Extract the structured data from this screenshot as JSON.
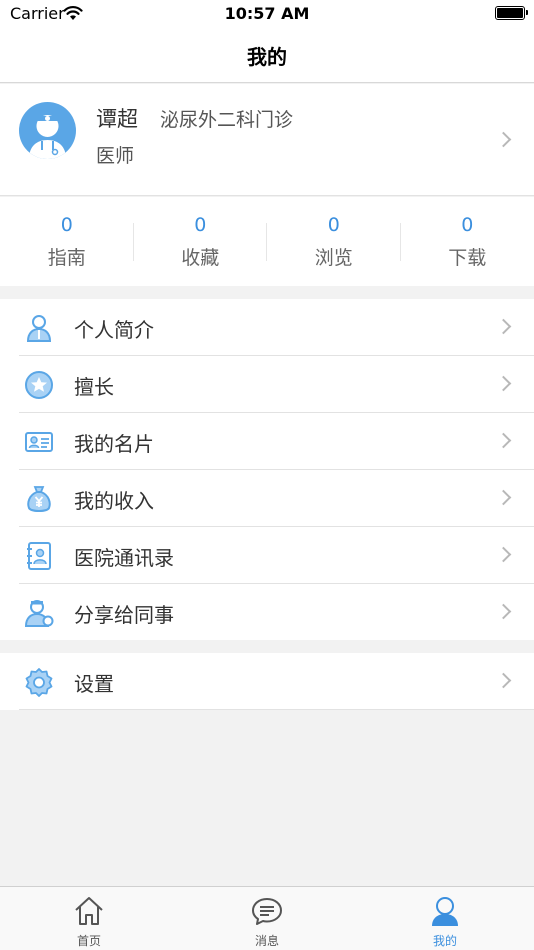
{
  "status_bar": {
    "carrier": "Carrier",
    "time": "10:57 AM"
  },
  "nav": {
    "title": "我的"
  },
  "profile": {
    "name": "谭超",
    "department": "泌尿外二科门诊",
    "title": "医师"
  },
  "stats": [
    {
      "value": "0",
      "label": "指南"
    },
    {
      "value": "0",
      "label": "收藏"
    },
    {
      "value": "0",
      "label": "浏览"
    },
    {
      "value": "0",
      "label": "下载"
    }
  ],
  "menu": [
    {
      "label": "个人简介",
      "icon": "person-icon"
    },
    {
      "label": "擅长",
      "icon": "star-badge-icon"
    },
    {
      "label": "我的名片",
      "icon": "business-card-icon"
    },
    {
      "label": "我的收入",
      "icon": "money-bag-icon"
    },
    {
      "label": "医院通讯录",
      "icon": "address-book-icon"
    },
    {
      "label": "分享给同事",
      "icon": "doctor-share-icon"
    }
  ],
  "settings": {
    "label": "设置",
    "icon": "gear-icon"
  },
  "tabs": [
    {
      "label": "首页",
      "icon": "home-icon"
    },
    {
      "label": "消息",
      "icon": "message-icon"
    },
    {
      "label": "我的",
      "icon": "profile-icon"
    }
  ],
  "colors": {
    "accent": "#3b8fde",
    "icon_blue": "#5aa6e6",
    "background": "#f2f2f2"
  }
}
